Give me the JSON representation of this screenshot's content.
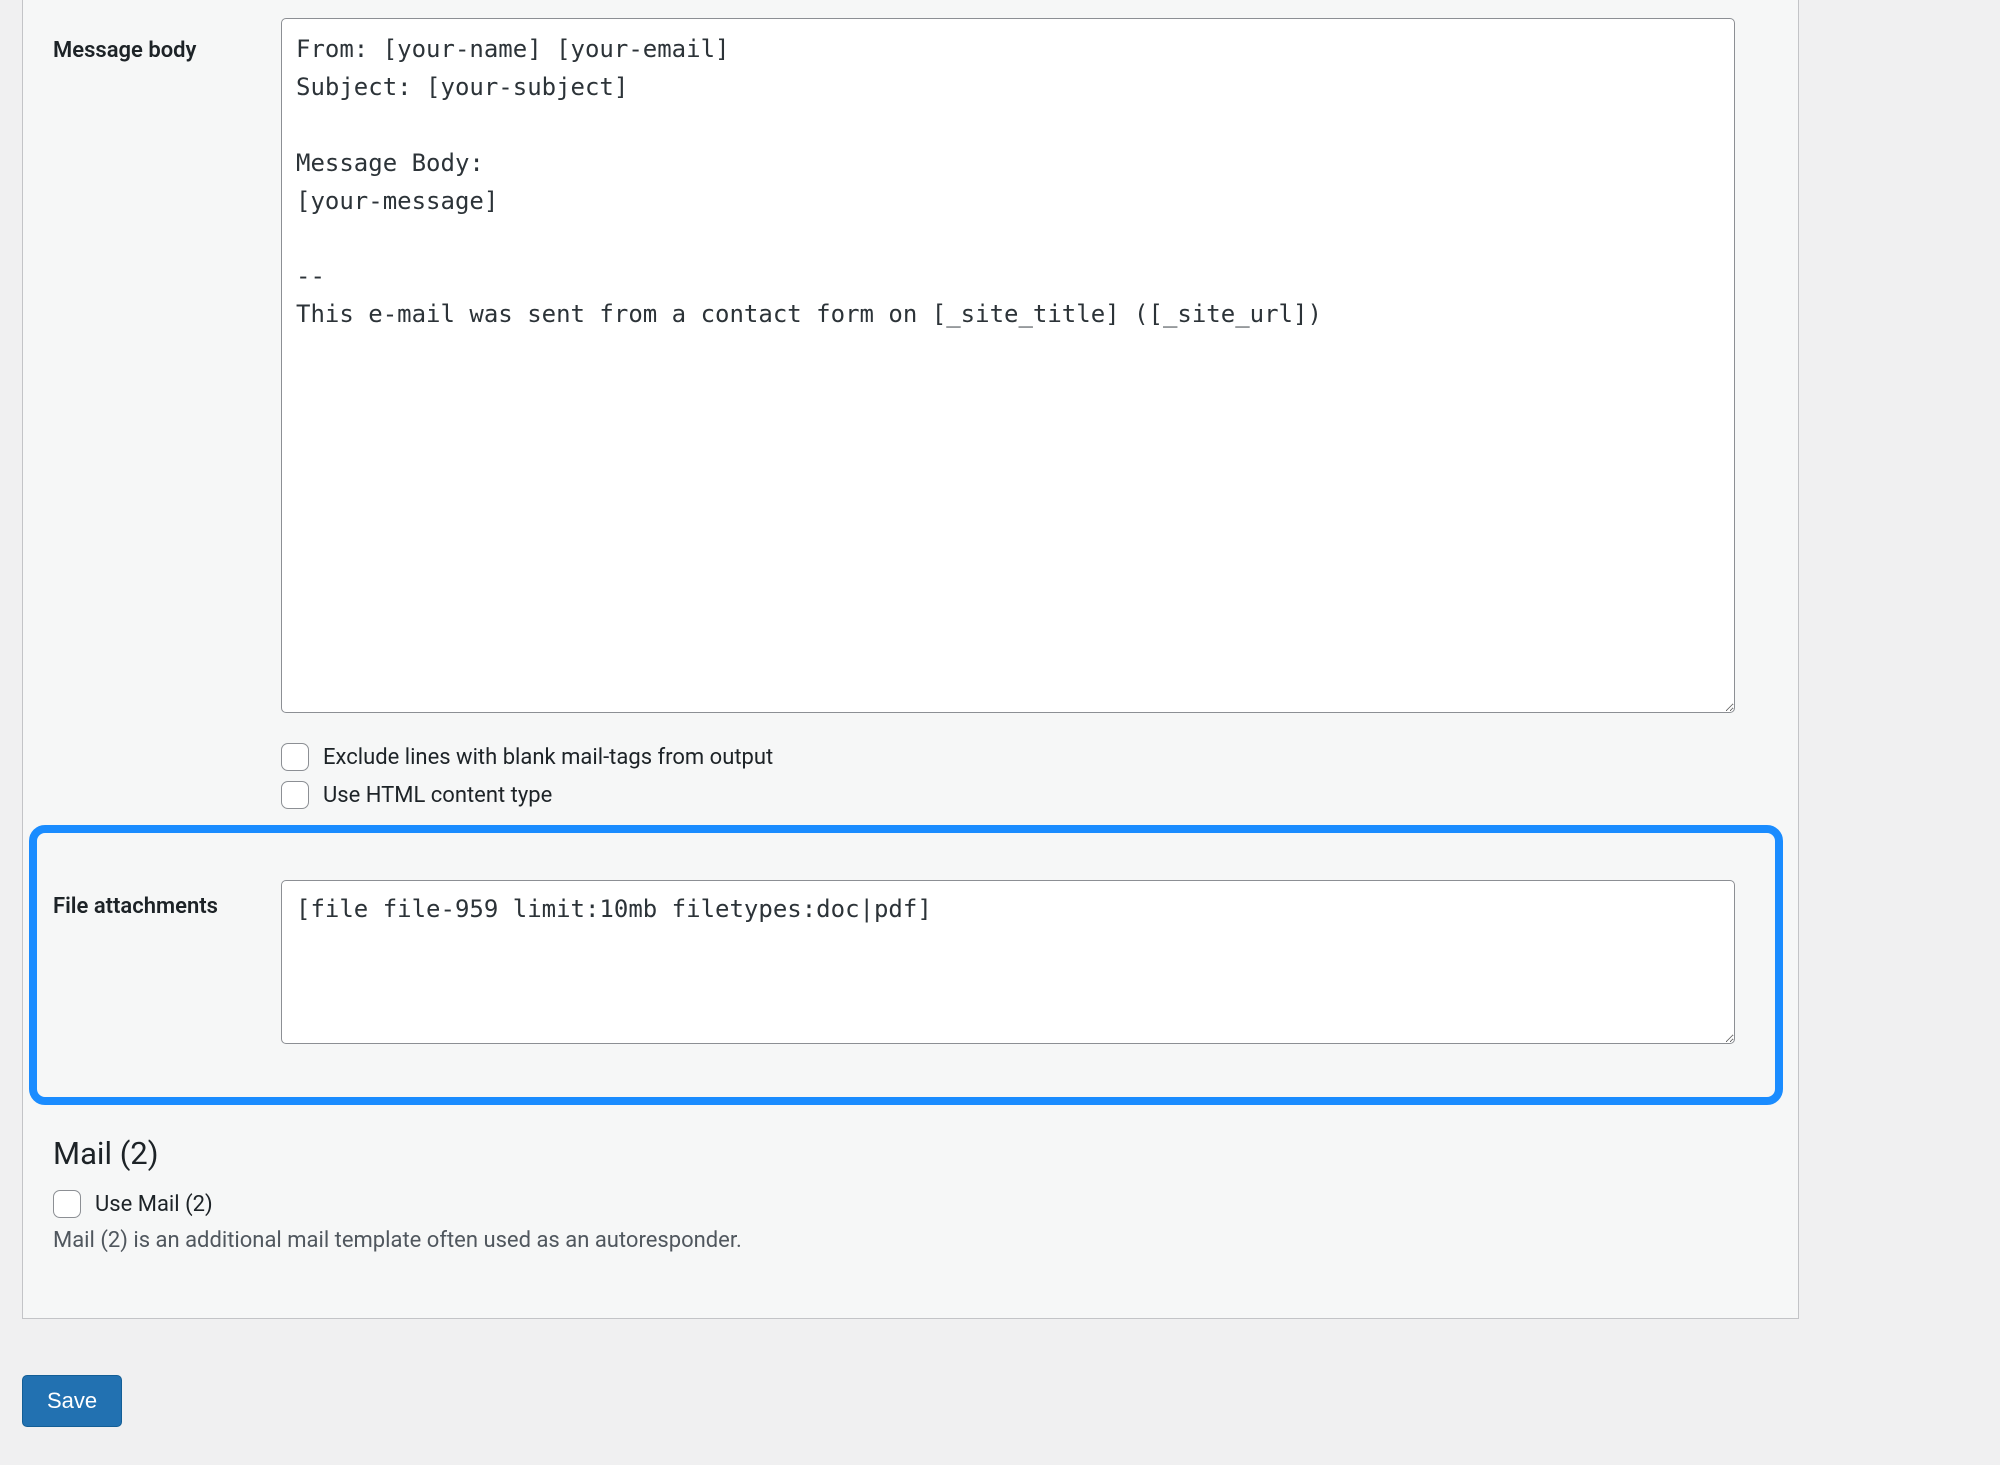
{
  "labels": {
    "message_body": "Message body",
    "file_attachments": "File attachments"
  },
  "message_body": "From: [your-name] [your-email]\nSubject: [your-subject]\n\nMessage Body:\n[your-message]\n\n--\nThis e-mail was sent from a contact form on [_site_title] ([_site_url])",
  "options": {
    "exclude_blank": {
      "checked": false,
      "label": "Exclude lines with blank mail-tags from output"
    },
    "use_html": {
      "checked": false,
      "label": "Use HTML content type"
    }
  },
  "file_attachments": "[file file-959 limit:10mb filetypes:doc|pdf]",
  "mail2": {
    "heading": "Mail (2)",
    "use": {
      "checked": false,
      "label": "Use Mail (2)"
    },
    "description": "Mail (2) is an additional mail template often used as an autoresponder."
  },
  "actions": {
    "save": "Save"
  }
}
